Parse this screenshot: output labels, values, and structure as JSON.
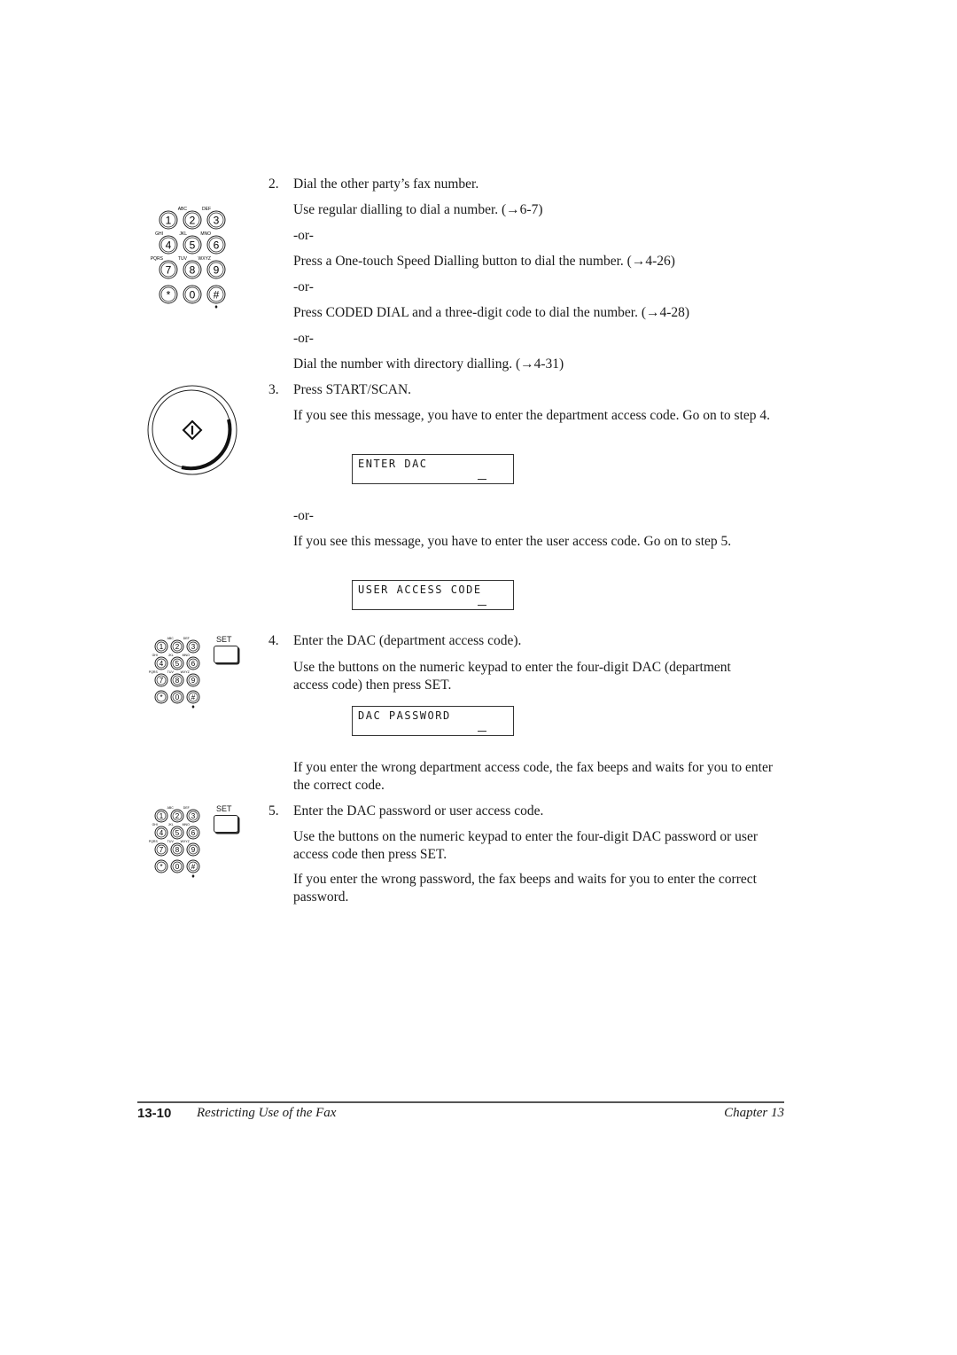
{
  "steps": [
    {
      "number": "2.",
      "title": "Dial the other party’s fax number.",
      "paragraphs": [
        "Use regular dialling to dial a number. (→6-7)",
        "-or-",
        "Press a One-touch Speed Dialling button to dial the number. (→4-26)",
        "-or-",
        "Press CODED DIAL and a three-digit code to dial the number. (→4-28)",
        "-or-",
        "Dial the number with directory dialling. (→4-31)"
      ]
    },
    {
      "number": "3.",
      "title": "Press START/SCAN.",
      "paragraphs": [
        "If you see this message, you have to enter the department access code. Go on to step 4.",
        "-or-",
        "If you see this message, you have to enter the user access code. Go on to step 5."
      ],
      "displays": [
        "ENTER DAC",
        "USER ACCESS CODE"
      ]
    },
    {
      "number": "4.",
      "title": "Enter the DAC (department access code).",
      "paragraphs": [
        "Use the buttons on the numeric keypad to enter the four-digit DAC (department access code) then press SET.",
        "If you enter the wrong department access code, the fax beeps and waits for you to enter the correct code."
      ],
      "displays": [
        "DAC PASSWORD"
      ]
    },
    {
      "number": "5.",
      "title": "Enter the DAC password or user access code.",
      "paragraphs": [
        "Use the buttons on the numeric keypad to enter the four-digit DAC password or user access code then press SET.",
        "If you enter the wrong password, the fax beeps and waits for you to enter the correct password."
      ]
    }
  ],
  "keypad": {
    "keys": [
      "1",
      "2",
      "3",
      "4",
      "5",
      "6",
      "7",
      "8",
      "9",
      "*",
      "0",
      "#"
    ],
    "letters": [
      "",
      "ABC",
      "DEF",
      "GHI",
      "JKL",
      "MNO",
      "PQRS",
      "TUV",
      "WXYZ",
      "",
      "",
      ""
    ],
    "set_label": "SET"
  },
  "footer": {
    "page_number": "13-10",
    "section_title": "Restricting Use of the Fax",
    "chapter": "Chapter 13"
  }
}
